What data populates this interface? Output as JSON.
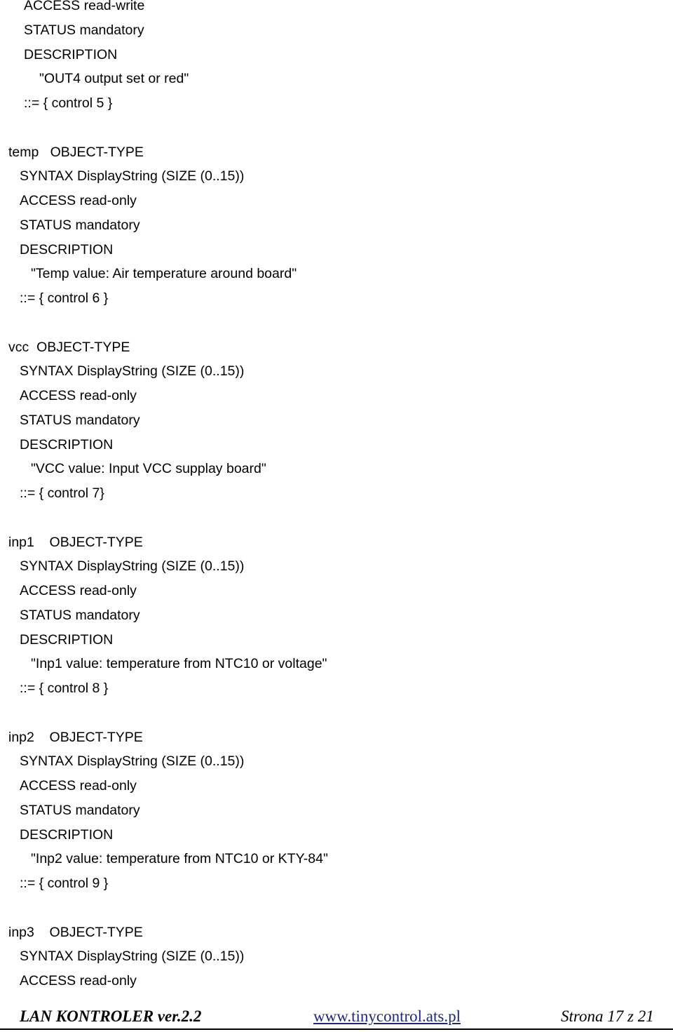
{
  "document": {
    "lines": [
      {
        "text": "ACCESS read-write",
        "indent": 2
      },
      {
        "text": "STATUS mandatory",
        "indent": 2
      },
      {
        "text": "DESCRIPTION",
        "indent": 2
      },
      {
        "text": "\"OUT4 output set or red\"",
        "indent": 3
      },
      {
        "text": "::= { control 5 }",
        "indent": 2
      },
      {
        "text": "",
        "indent": 0
      },
      {
        "text": "temp   OBJECT-TYPE",
        "indent": 0
      },
      {
        "text": "SYNTAX DisplayString (SIZE (0..15))",
        "indent": 1
      },
      {
        "text": "ACCESS read-only",
        "indent": 1
      },
      {
        "text": "STATUS mandatory",
        "indent": 1
      },
      {
        "text": "DESCRIPTION",
        "indent": 1
      },
      {
        "text": "\"Temp value: Air temperature around board\"",
        "indent": 4
      },
      {
        "text": "::= { control 6 }",
        "indent": 1
      },
      {
        "text": "",
        "indent": 0
      },
      {
        "text": "vcc  OBJECT-TYPE",
        "indent": 0
      },
      {
        "text": "SYNTAX DisplayString (SIZE (0..15))",
        "indent": 1
      },
      {
        "text": "ACCESS read-only",
        "indent": 1
      },
      {
        "text": "STATUS mandatory",
        "indent": 1
      },
      {
        "text": "DESCRIPTION",
        "indent": 1
      },
      {
        "text": "\"VCC value: Input VCC supplay board\"",
        "indent": 4
      },
      {
        "text": "::= { control 7}",
        "indent": 1
      },
      {
        "text": "",
        "indent": 0
      },
      {
        "text": "inp1    OBJECT-TYPE",
        "indent": 0
      },
      {
        "text": "SYNTAX DisplayString (SIZE (0..15))",
        "indent": 1
      },
      {
        "text": "ACCESS read-only",
        "indent": 1
      },
      {
        "text": "STATUS mandatory",
        "indent": 1
      },
      {
        "text": "DESCRIPTION",
        "indent": 1
      },
      {
        "text": "\"Inp1 value: temperature from NTC10 or voltage\"",
        "indent": 4
      },
      {
        "text": "::= { control 8 }",
        "indent": 1
      },
      {
        "text": "",
        "indent": 0
      },
      {
        "text": "inp2    OBJECT-TYPE",
        "indent": 0
      },
      {
        "text": "SYNTAX DisplayString (SIZE (0..15))",
        "indent": 1
      },
      {
        "text": "ACCESS read-only",
        "indent": 1
      },
      {
        "text": "STATUS mandatory",
        "indent": 1
      },
      {
        "text": "DESCRIPTION",
        "indent": 1
      },
      {
        "text": "\"Inp2 value: temperature from NTC10 or KTY-84\"",
        "indent": 4
      },
      {
        "text": "::= { control 9 }",
        "indent": 1
      },
      {
        "text": "",
        "indent": 0
      },
      {
        "text": "inp3    OBJECT-TYPE",
        "indent": 0
      },
      {
        "text": "SYNTAX DisplayString (SIZE (0..15))",
        "indent": 1
      },
      {
        "text": "ACCESS read-only",
        "indent": 1
      }
    ]
  },
  "footer": {
    "title": "LAN KONTROLER  ver.2.2",
    "link": "www.tinycontrol.ats.pl",
    "page": "Strona 17 z 21",
    "link_color": "#1f2680"
  }
}
